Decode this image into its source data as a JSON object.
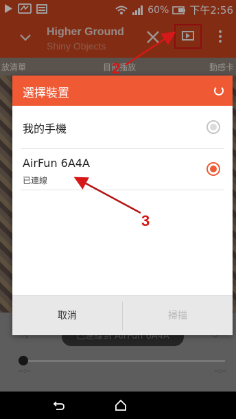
{
  "status_bar": {
    "battery": "60%",
    "time": "下午2:56"
  },
  "action_bar": {
    "title": "Higher Ground",
    "subtitle": "Shiny Objects"
  },
  "tabs": [
    "放清單",
    "目前播放",
    "動感卡"
  ],
  "dialog": {
    "title": "選擇裝置",
    "devices": [
      {
        "name": "我的手機",
        "status": "",
        "selected": false
      },
      {
        "name": "AirFun 6A4A",
        "status": "已連線",
        "selected": true
      }
    ],
    "cancel_label": "取消",
    "scan_label": "掃描"
  },
  "player": {
    "connected_text": "已連線到 AirFun 6A4A",
    "time_left": "--:--",
    "time_right": "--:--"
  },
  "annotations": {
    "step2": "2",
    "step3": "3",
    "color": "#d61818"
  },
  "colors": {
    "accent": "#ef5a35",
    "actionbar": "#c94420"
  }
}
